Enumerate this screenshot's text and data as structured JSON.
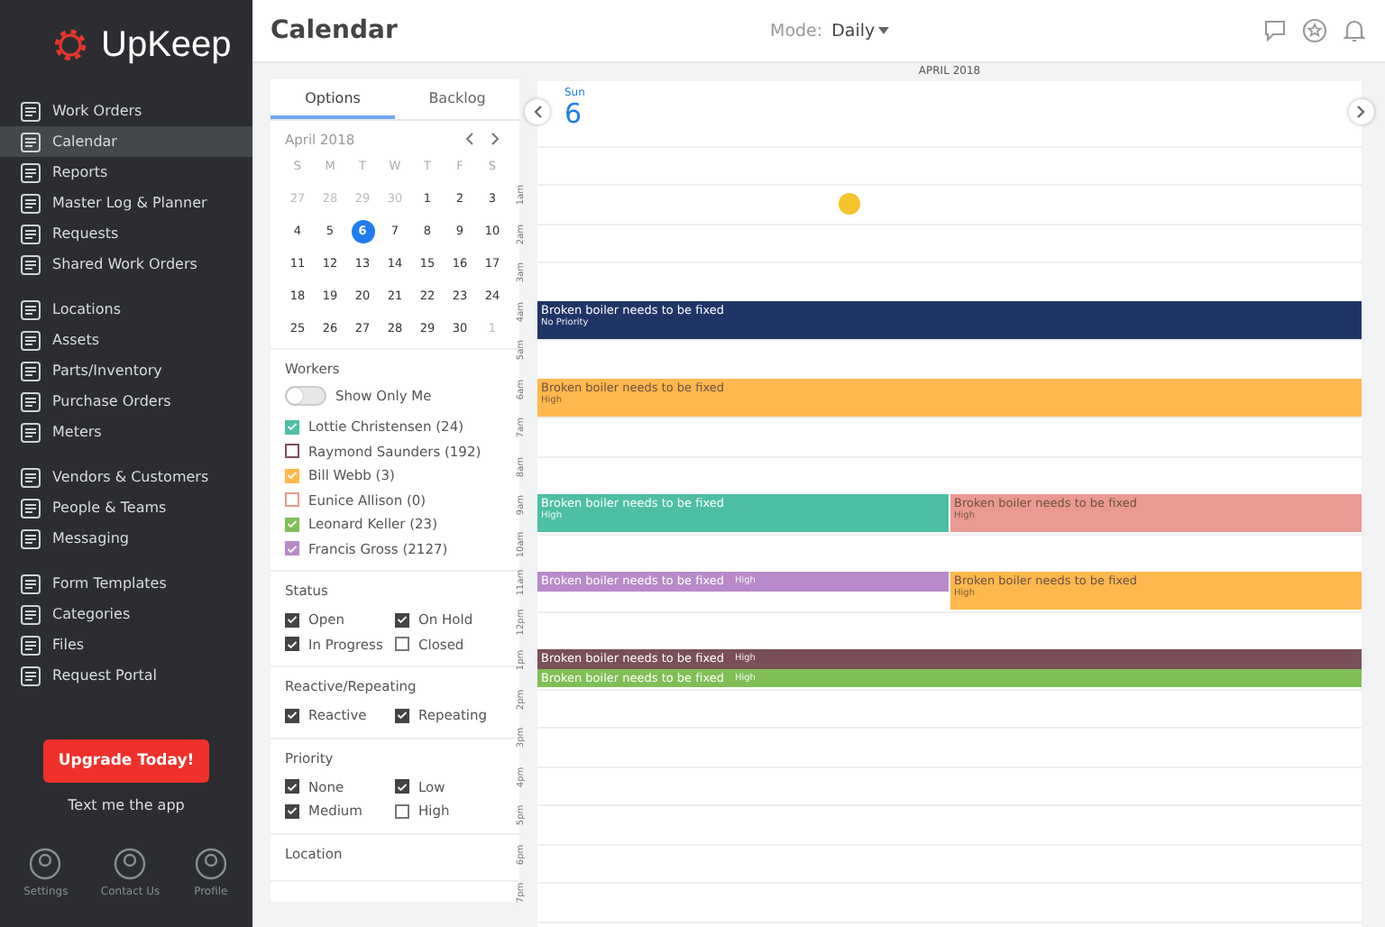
{
  "sidebar": {
    "logo": "UpKeep",
    "groups": [
      [
        {
          "label": "Work Orders",
          "selected": false
        },
        {
          "label": "Calendar",
          "selected": true
        },
        {
          "label": "Reports",
          "selected": false
        },
        {
          "label": "Master Log & Planner",
          "selected": false
        },
        {
          "label": "Requests",
          "selected": false
        },
        {
          "label": "Shared Work Orders",
          "selected": false
        }
      ],
      [
        {
          "label": "Locations",
          "selected": false
        },
        {
          "label": "Assets",
          "selected": false
        },
        {
          "label": "Parts/Inventory",
          "selected": false
        },
        {
          "label": "Purchase Orders",
          "selected": false
        },
        {
          "label": "Meters",
          "selected": false
        }
      ],
      [
        {
          "label": "Vendors & Customers",
          "selected": false
        },
        {
          "label": "People & Teams",
          "selected": false
        },
        {
          "label": "Messaging",
          "selected": false
        }
      ],
      [
        {
          "label": "Form Templates",
          "selected": false
        },
        {
          "label": "Categories",
          "selected": false
        },
        {
          "label": "Files",
          "selected": false
        },
        {
          "label": "Request Portal",
          "selected": false
        }
      ]
    ],
    "upgrade_button": "Upgrade Today!",
    "text_link": "Text me the app",
    "footer": [
      "Settings",
      "Contact Us",
      "Profile"
    ]
  },
  "header": {
    "title": "Calendar",
    "mode_label": "Mode:",
    "mode_value": "Daily"
  },
  "options": {
    "tabs": [
      {
        "label": "Options",
        "selected": true
      },
      {
        "label": "Backlog",
        "selected": false
      }
    ],
    "mini_calendar": {
      "month": "April 2018",
      "weekdays": [
        "S",
        "M",
        "T",
        "W",
        "T",
        "F",
        "S"
      ],
      "weeks": [
        [
          {
            "day": "27",
            "muted": true,
            "selected": false
          },
          {
            "day": "28",
            "muted": true,
            "selected": false
          },
          {
            "day": "29",
            "muted": true,
            "selected": false
          },
          {
            "day": "30",
            "muted": true,
            "selected": false
          },
          {
            "day": "1",
            "muted": false,
            "selected": false
          },
          {
            "day": "2",
            "muted": false,
            "selected": false
          },
          {
            "day": "3",
            "muted": false,
            "selected": false
          }
        ],
        [
          {
            "day": "4",
            "muted": false,
            "selected": false
          },
          {
            "day": "5",
            "muted": false,
            "selected": false
          },
          {
            "day": "6",
            "muted": false,
            "selected": true
          },
          {
            "day": "7",
            "muted": false,
            "selected": false
          },
          {
            "day": "8",
            "muted": false,
            "selected": false
          },
          {
            "day": "9",
            "muted": false,
            "selected": false
          },
          {
            "day": "10",
            "muted": false,
            "selected": false
          }
        ],
        [
          {
            "day": "11",
            "muted": false,
            "selected": false
          },
          {
            "day": "12",
            "muted": false,
            "selected": false
          },
          {
            "day": "13",
            "muted": false,
            "selected": false
          },
          {
            "day": "14",
            "muted": false,
            "selected": false
          },
          {
            "day": "15",
            "muted": false,
            "selected": false
          },
          {
            "day": "16",
            "muted": false,
            "selected": false
          },
          {
            "day": "17",
            "muted": false,
            "selected": false
          }
        ],
        [
          {
            "day": "18",
            "muted": false,
            "selected": false
          },
          {
            "day": "19",
            "muted": false,
            "selected": false
          },
          {
            "day": "20",
            "muted": false,
            "selected": false
          },
          {
            "day": "21",
            "muted": false,
            "selected": false
          },
          {
            "day": "22",
            "muted": false,
            "selected": false
          },
          {
            "day": "23",
            "muted": false,
            "selected": false
          },
          {
            "day": "24",
            "muted": false,
            "selected": false
          }
        ],
        [
          {
            "day": "25",
            "muted": false,
            "selected": false
          },
          {
            "day": "26",
            "muted": false,
            "selected": false
          },
          {
            "day": "27",
            "muted": false,
            "selected": false
          },
          {
            "day": "28",
            "muted": false,
            "selected": false
          },
          {
            "day": "29",
            "muted": false,
            "selected": false
          },
          {
            "day": "30",
            "muted": false,
            "selected": false
          },
          {
            "day": "1",
            "muted": true,
            "selected": false
          }
        ]
      ]
    },
    "workers": {
      "title": "Workers",
      "toggle": {
        "label": "Show Only Me",
        "on": false
      },
      "items": [
        {
          "label": "Lottie Christensen (24)",
          "checked": true,
          "color": "#4dbfa4"
        },
        {
          "label": "Raymond Saunders (192)",
          "checked": false,
          "color": "#7a4f57"
        },
        {
          "label": "Bill Webb (3)",
          "checked": true,
          "color": "#ffb84d"
        },
        {
          "label": "Eunice Allison (0)",
          "checked": false,
          "color": "#eb9a92"
        },
        {
          "label": "Leonard Keller (23)",
          "checked": true,
          "color": "#7fbf56"
        },
        {
          "label": "Francis Gross (2127)",
          "checked": true,
          "color": "#b88ac9"
        }
      ]
    },
    "filters": [
      {
        "title": "Status",
        "items": [
          {
            "label": "Open",
            "checked": true
          },
          {
            "label": "On Hold",
            "checked": true
          },
          {
            "label": "In Progress",
            "checked": true
          },
          {
            "label": "Closed",
            "checked": false
          }
        ]
      },
      {
        "title": "Reactive/Repeating",
        "items": [
          {
            "label": "Reactive",
            "checked": true
          },
          {
            "label": "Repeating",
            "checked": true
          }
        ]
      },
      {
        "title": "Priority",
        "items": [
          {
            "label": "None",
            "checked": true
          },
          {
            "label": "Low",
            "checked": true
          },
          {
            "label": "Medium",
            "checked": true
          },
          {
            "label": "High",
            "checked": false
          }
        ]
      },
      {
        "title": "Location"
      }
    ]
  },
  "day_view": {
    "month": "APRIL 2018",
    "weekday": "Sun",
    "day": "6",
    "hours": [
      {
        "label": "1am"
      },
      {
        "label": "2am"
      },
      {
        "label": "3am"
      },
      {
        "label": "4am",
        "events": [
          {
            "title": "Broken boiler needs to be fixed",
            "priority": "No Priority",
            "color": "#1f3566",
            "compact": false
          }
        ]
      },
      {
        "label": "5am"
      },
      {
        "label": "6am",
        "events": [
          {
            "title": "Broken boiler needs to be fixed",
            "priority": "High",
            "color": "#ffb84d",
            "compact": false
          }
        ]
      },
      {
        "label": "7am"
      },
      {
        "label": "8am"
      },
      {
        "label": "9am",
        "columns": [
          [
            {
              "title": "Broken boiler needs to be fixed",
              "priority": "High",
              "color": "#4dbfa4",
              "compact": false
            }
          ],
          [
            {
              "title": "Broken boiler needs to be fixed",
              "priority": "High",
              "color": "#eb9a92",
              "compact": false
            }
          ]
        ]
      },
      {
        "label": "10am"
      },
      {
        "label": "11am",
        "columns": [
          [
            {
              "title": "Broken boiler needs to be fixed",
              "priority": "High",
              "color": "#b88ac9",
              "compact": true
            }
          ],
          [
            {
              "title": "Broken boiler needs to be fixed",
              "priority": "High",
              "color": "#ffb84d",
              "compact": false
            }
          ]
        ]
      },
      {
        "label": "12pm"
      },
      {
        "label": "1pm",
        "events": [
          {
            "title": "Broken boiler needs to be fixed",
            "priority": "High",
            "color": "#7a4f57",
            "compact": true
          },
          {
            "title": "Broken boiler needs to be fixed",
            "priority": "High",
            "color": "#7fbf56",
            "compact": true
          }
        ]
      },
      {
        "label": "2pm"
      },
      {
        "label": "3pm"
      },
      {
        "label": "4pm"
      },
      {
        "label": "5pm"
      },
      {
        "label": "6pm"
      },
      {
        "label": "7pm"
      }
    ]
  }
}
